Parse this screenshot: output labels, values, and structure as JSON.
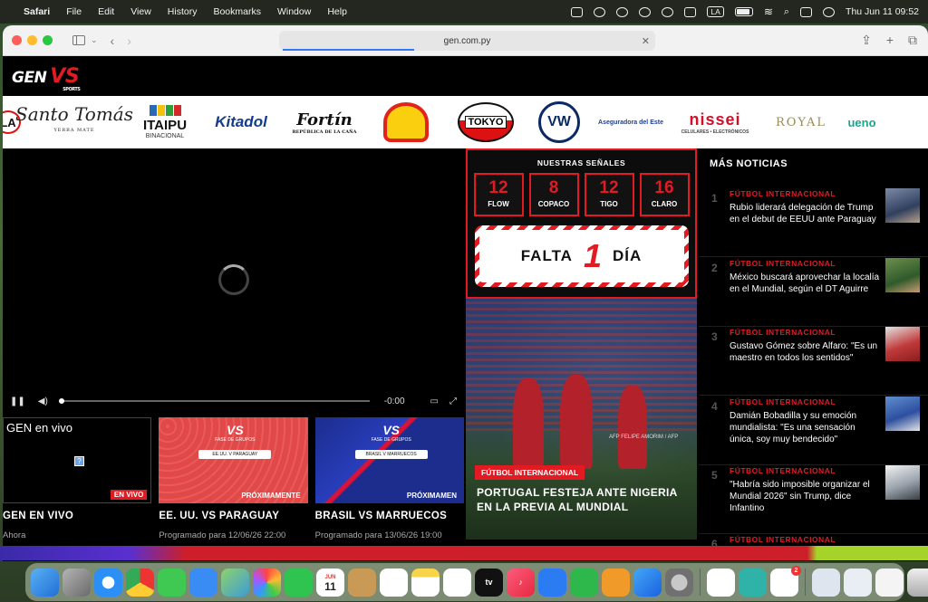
{
  "menubar": {
    "app": "Safari",
    "items": [
      "File",
      "Edit",
      "View",
      "History",
      "Bookmarks",
      "Window",
      "Help"
    ],
    "input_source": "LA",
    "datetime": "Thu Jun 11  09:52"
  },
  "browser": {
    "url": "gen.com.py",
    "load_progress": 0.35
  },
  "site": {
    "logo_gen": "GEN",
    "logo_vs": "VS",
    "logo_sports": "SPORTS"
  },
  "sponsors": {
    "la": "LA",
    "santo": "Santo Tomás",
    "santo_sub": "YERBA MATE",
    "itaipu": "ITAIPU",
    "itaipu_sub": "BINACIONAL",
    "kitadol": "Kitadol",
    "fortin": "Fortín",
    "fortin_sub": "REPÚBLICA DE LA CAÑA",
    "tokyo": "TOKYO",
    "vw": "VW",
    "asegur": "Aseguradora del Este",
    "nissei": "nissei",
    "nissei_sub": "CELULARES • ELECTRÓNICOS",
    "royal": "ROYAL",
    "ueno": "ueno"
  },
  "player": {
    "time": "-0:00"
  },
  "videos": [
    {
      "thumb_label": "GEN en vivo",
      "tag": "EN VIVO",
      "title": "GEN EN VIVO",
      "subtitle": "Ahora"
    },
    {
      "card_vs": "VS",
      "card_fase": "FASE DE GRUPOS",
      "card_match": "EE.UU. V PARAGUAY",
      "tag": "PRÓXIMAMENTE",
      "title": "EE. UU. VS PARAGUAY",
      "subtitle": "Programado para 12/06/26 22:00"
    },
    {
      "card_vs": "VS",
      "card_fase": "FASE DE GRUPOS",
      "card_match": "BRASIL V MARRUECOS",
      "tag": "PRÓXIMAMEN",
      "title": "BRASIL VS MARRUECOS",
      "subtitle": "Programado para 13/06/26 19:00"
    }
  ],
  "signals": {
    "heading": "NUESTRAS SEÑALES",
    "channels": [
      {
        "num": "12",
        "name": "FLOW"
      },
      {
        "num": "8",
        "name": "COPACO"
      },
      {
        "num": "12",
        "name": "TIGO"
      },
      {
        "num": "16",
        "name": "CLARO"
      }
    ],
    "countdown_pre": "FALTA",
    "countdown_num": "1",
    "countdown_post": "DÍA"
  },
  "hero": {
    "category": "FÚTBOL INTERNACIONAL",
    "headline": "PORTUGAL FESTEJA ANTE NIGERIA EN LA PREVIA AL MUNDIAL",
    "credit": "AFP FELIPE AMORIM / AFP"
  },
  "news": {
    "heading": "MÁS NOTICIAS",
    "items": [
      {
        "rank": "1",
        "category": "FÚTBOL INTERNACIONAL",
        "text": "Rubio liderará delegación de Trump en el debut de EEUU ante Paraguay"
      },
      {
        "rank": "2",
        "category": "FÚTBOL INTERNACIONAL",
        "text": "México buscará aprovechar la localía en el Mundial, según el DT Aguirre"
      },
      {
        "rank": "3",
        "category": "FÚTBOL INTERNACIONAL",
        "text": "Gustavo Gómez sobre Alfaro: \"Es un maestro en todos los sentidos\""
      },
      {
        "rank": "4",
        "category": "FÚTBOL INTERNACIONAL",
        "text": "Damián Bobadilla y su emoción mundialista: \"Es una sensación única, soy muy bendecido\""
      },
      {
        "rank": "5",
        "category": "FÚTBOL INTERNACIONAL",
        "text": "\"Habría sido imposible organizar el Mundial 2026\" sin Trump, dice Infantino"
      },
      {
        "rank": "6",
        "category": "FÚTBOL INTERNACIONAL",
        "text": ""
      }
    ]
  },
  "dock": {
    "calendar_month": "JUN",
    "calendar_day": "11",
    "tv_label": "tv",
    "badge": "2"
  },
  "colors": {
    "brand_red": "#e21b22",
    "background": "#000000"
  }
}
